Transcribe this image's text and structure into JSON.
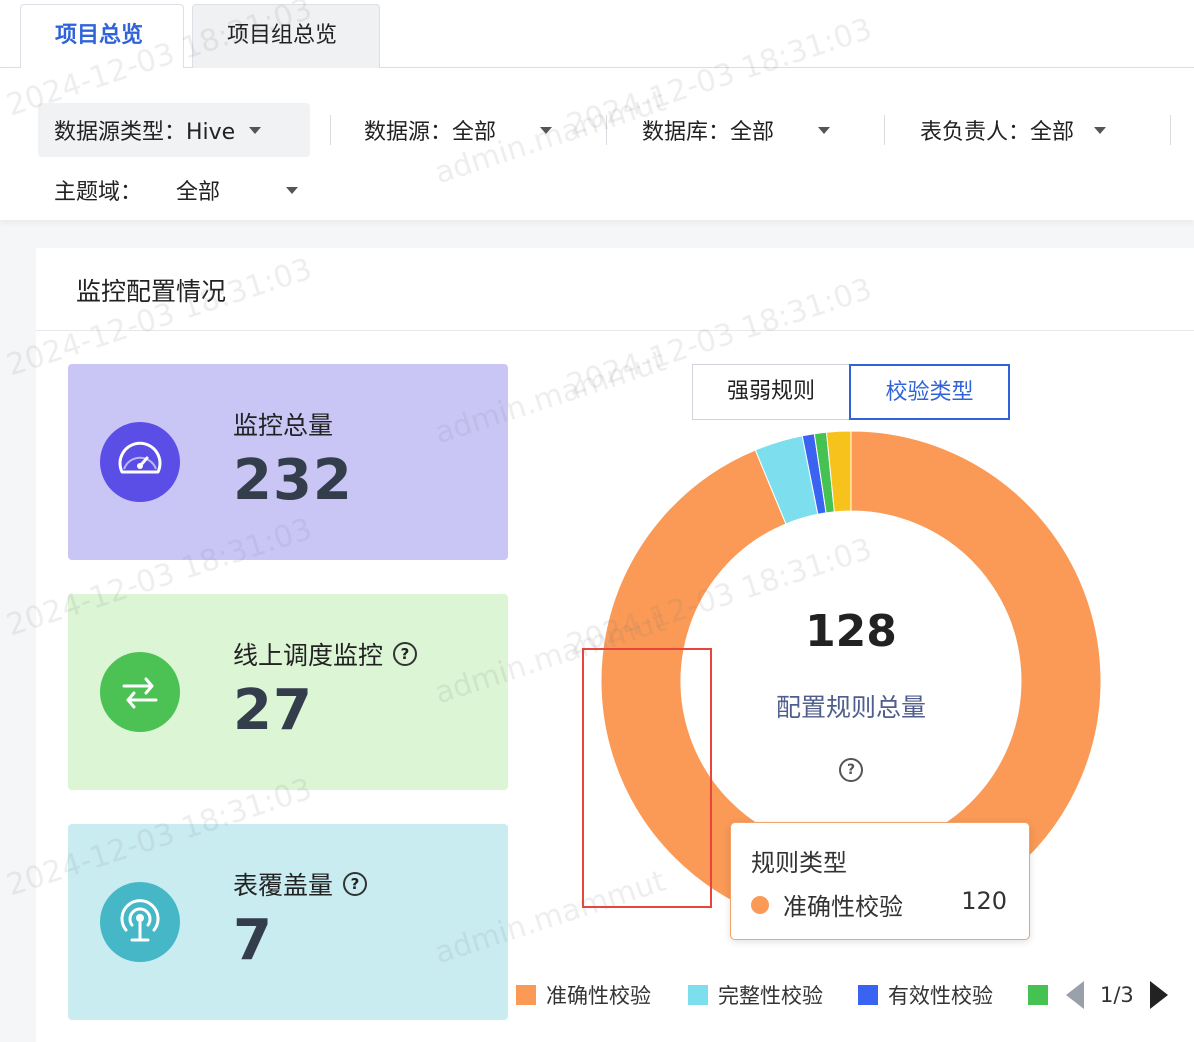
{
  "tabs": [
    {
      "label": "项目总览",
      "active": true
    },
    {
      "label": "项目组总览",
      "active": false
    }
  ],
  "filters": {
    "datasource_type": "数据源类型：Hive",
    "datasource": "数据源：全部",
    "database": "数据库：全部",
    "table_owner": "表负责人：全部",
    "subject_domain_label": "主题域：",
    "subject_domain_value": "全部"
  },
  "section": {
    "title": "监控配置情况"
  },
  "stats": [
    {
      "label": "监控总量",
      "value": "232",
      "color": "#c9c6f6",
      "icon_color": "#5b4ee6",
      "icon": "gauge-icon"
    },
    {
      "label": "线上调度监控",
      "value": "27",
      "color": "#dcf5d5",
      "icon_color": "#4cc154",
      "icon": "swap-arrows-icon"
    },
    {
      "label": "表覆盖量",
      "value": "7",
      "color": "#c9ecf1",
      "icon_color": "#45b7c6",
      "icon": "broadcast-icon"
    }
  ],
  "toggle": {
    "option1": "强弱规则",
    "option2": "校验类型",
    "selected": "校验类型"
  },
  "donut": {
    "center_value": "128",
    "center_label": "配置规则总量",
    "segments": [
      {
        "name": "准确性校验",
        "value": 120,
        "color": "#fa9a56"
      },
      {
        "name": "完整性校验",
        "value": 4,
        "color": "#7ddfee"
      },
      {
        "name": "有效性校验",
        "value": 1,
        "color": "#3a63f2"
      },
      {
        "name": "green",
        "value": 1,
        "color": "#46c252"
      },
      {
        "name": "yellow",
        "value": 2,
        "color": "#f7c21c"
      }
    ]
  },
  "tooltip": {
    "title": "规则类型",
    "item_name": "准确性校验",
    "item_value": "120"
  },
  "legend": {
    "items": [
      {
        "name": "准确性校验",
        "color": "#fa9a56"
      },
      {
        "name": "完整性校验",
        "color": "#7ddfee"
      },
      {
        "name": "有效性校验",
        "color": "#3a63f2"
      },
      {
        "name": "",
        "color": "#46c252"
      }
    ],
    "page": "1/3"
  },
  "watermark": {
    "user": "admin.mammut",
    "time": "2024-12-03 18:31:03"
  }
}
